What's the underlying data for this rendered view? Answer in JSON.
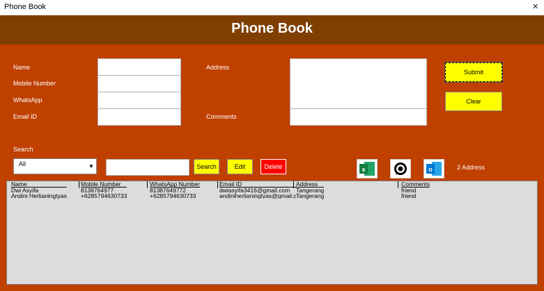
{
  "window": {
    "title": "Phone Book",
    "close": "×"
  },
  "header": {
    "title": "Phone Book"
  },
  "labels": {
    "name": "Name",
    "mobile": "Mobile Number",
    "whatsapp": "WhatsApp",
    "email": "Email ID",
    "address": "Address",
    "comments": "Comments",
    "search": "Search"
  },
  "inputs": {
    "name": "",
    "mobile": "",
    "whatsapp": "",
    "email": "",
    "address": "",
    "comments": "",
    "search": ""
  },
  "buttons": {
    "submit": "Submit",
    "clear": "Clear",
    "search": "Search",
    "edit": "Edit",
    "delete": "Delete"
  },
  "combo": {
    "value": "All"
  },
  "icons": {
    "excel": "excel-icon",
    "whatsapp": "whatsapp-icon",
    "outlook": "outlook-icon",
    "excel_glyph": "x",
    "outlook_glyph": "o"
  },
  "count": "2 Address",
  "table": {
    "columns": [
      "Name",
      "Mobile Number",
      "WhatsApp Number",
      "Email ID",
      "Address",
      "Comments"
    ],
    "rows": [
      [
        "Dwi Asyifa",
        "8138764977",
        "81387649772",
        "dwiasyifa3416@gmail.com",
        "Tangerang",
        "friend"
      ],
      [
        "Andini Herlianingtyas",
        "+6285794630733",
        "+6285794630733",
        "andiniherlianingtyas@gmail.c",
        "Tangerang",
        "friend"
      ]
    ]
  },
  "colors": {
    "form_bg": "#c04000",
    "header_bg": "#7f3f00",
    "button_yellow": "#ffff00",
    "button_red": "#ff0000",
    "list_bg": "#dcdcdc"
  }
}
